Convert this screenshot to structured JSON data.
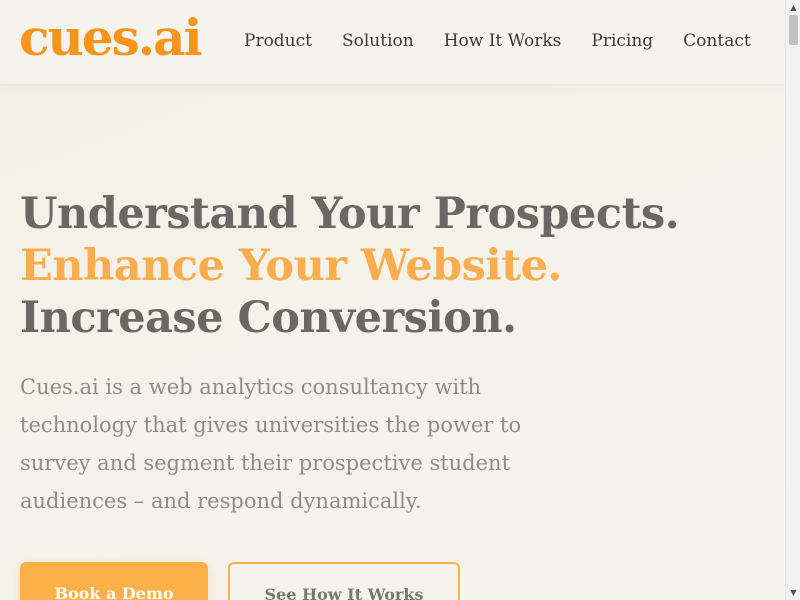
{
  "header": {
    "logo": "cues.ai",
    "nav": [
      "Product",
      "Solution",
      "How It Works",
      "Pricing",
      "Contact"
    ]
  },
  "hero": {
    "line1": "Understand Your Prospects.",
    "line2": "Enhance Your Website.",
    "line3": "Increase Conversion.",
    "description": "Cues.ai is a web analytics consultancy with technology that gives universities the power to survey and segment their prospective student audiences – and respond dynamically.",
    "primary_button": "Book a Demo",
    "secondary_button": "See How It Works"
  },
  "scrollbar": {
    "up_icon": "▲",
    "down_icon": "▼"
  },
  "colors": {
    "brand": "#f7941d",
    "accent": "#f9ad4e",
    "heading": "#6a6865",
    "body_text": "#8f8c86"
  }
}
